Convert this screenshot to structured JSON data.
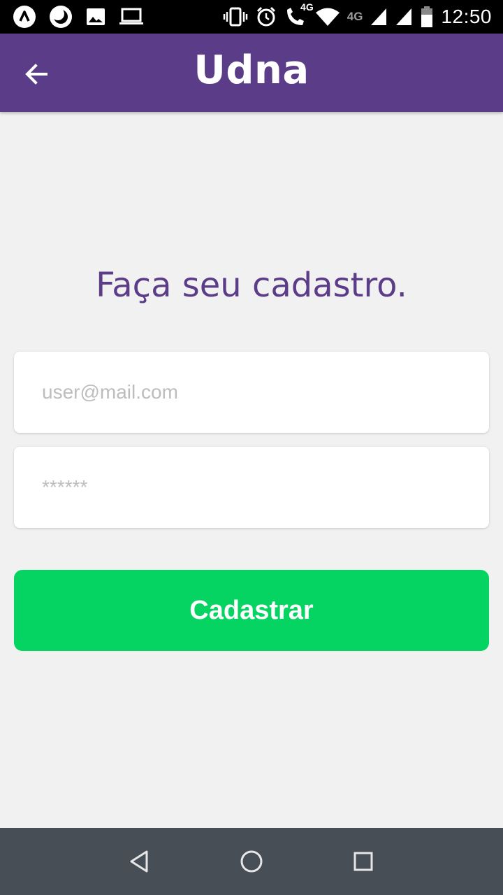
{
  "status_bar": {
    "time": "12:50",
    "network_label_a": "4G",
    "network_label_b": "4G",
    "icons": [
      "app-a-icon",
      "moon-icon",
      "image-icon",
      "laptop-icon",
      "vibrate-icon",
      "alarm-icon",
      "volte-call-icon",
      "wifi-icon",
      "signal-icon",
      "signal-icon",
      "battery-icon"
    ]
  },
  "app_bar": {
    "title": "Udna",
    "back_icon": "arrow-left-icon",
    "color": "#5b3c88"
  },
  "form": {
    "heading": "Faça seu cadastro.",
    "email_placeholder": "user@mail.com",
    "password_placeholder": "******",
    "submit_label": "Cadastrar",
    "submit_color": "#05d462"
  },
  "nav_bar": {
    "icons": [
      "back-triangle-icon",
      "home-circle-icon",
      "recents-square-icon"
    ]
  }
}
